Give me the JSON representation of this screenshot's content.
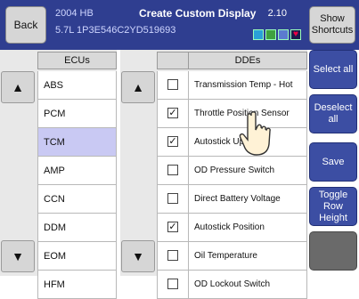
{
  "header": {
    "back_label": "Back",
    "year_model": "2004 HB",
    "vin": "5.7L  1P3E546C2YD519693",
    "title": "Create Custom Display",
    "version": "2.10",
    "shortcuts_label": "Show\nShortcuts"
  },
  "ecus": {
    "header": "ECUs",
    "items": [
      "ABS",
      "PCM",
      "TCM",
      "AMP",
      "CCN",
      "DDM",
      "EOM",
      "HFM"
    ],
    "selected": "TCM"
  },
  "ddes": {
    "header": "DDEs",
    "items": [
      {
        "label": "Transmission Temp - Hot",
        "checked": false
      },
      {
        "label": "Throttle Position Sensor",
        "checked": true
      },
      {
        "label": "Autostick Up Shift",
        "checked": true
      },
      {
        "label": "OD Pressure Switch",
        "checked": false
      },
      {
        "label": "Direct Battery Voltage",
        "checked": false
      },
      {
        "label": "Autostick Position",
        "checked": true
      },
      {
        "label": "Oil Temperature",
        "checked": false
      },
      {
        "label": "OD Lockout Switch",
        "checked": false
      }
    ]
  },
  "side_buttons": {
    "select_all": "Select all",
    "deselect_all": "Deselect\nall",
    "save": "Save",
    "toggle_row": "Toggle\nRow\nHeight"
  },
  "scroll": {
    "up_glyph": "▲",
    "down_glyph": "▼"
  },
  "colors": {
    "header_bg": "#2f3e90",
    "button_blue": "#3c4ea3",
    "selected_row": "#c9c9f3"
  }
}
